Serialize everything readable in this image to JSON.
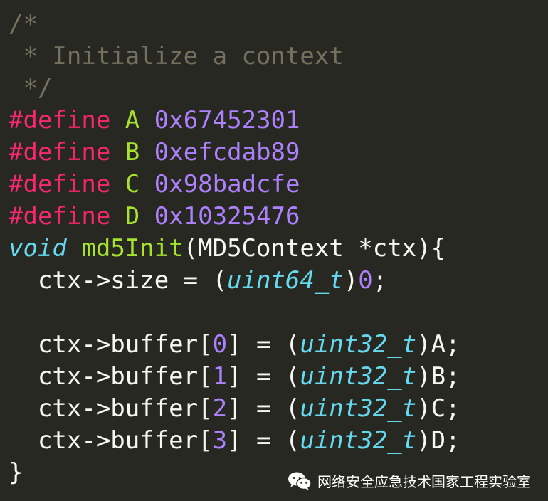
{
  "code": {
    "comment_open": "/*",
    "comment_body": " * Initialize a context",
    "comment_close": " */",
    "define_keyword": "#define",
    "defines": [
      {
        "name": "A",
        "value": "0x67452301"
      },
      {
        "name": "B",
        "value": "0xefcdab89"
      },
      {
        "name": "C",
        "value": "0x98badcfe"
      },
      {
        "name": "D",
        "value": "0x10325476"
      }
    ],
    "func_return_type": "void",
    "func_name": "md5Init",
    "func_params": "(MD5Context *ctx){",
    "size_line": {
      "lhs": "  ctx->size = (",
      "cast_type": "uint64_t",
      "close": ")",
      "value": "0",
      "end": ";"
    },
    "buffer_lines": [
      {
        "lhs": "  ctx->buffer[",
        "index": "0",
        "mid": "] = (",
        "cast_type": "uint32_t",
        "rhs": ")A;"
      },
      {
        "lhs": "  ctx->buffer[",
        "index": "1",
        "mid": "] = (",
        "cast_type": "uint32_t",
        "rhs": ")B;"
      },
      {
        "lhs": "  ctx->buffer[",
        "index": "2",
        "mid": "] = (",
        "cast_type": "uint32_t",
        "rhs": ")C;"
      },
      {
        "lhs": "  ctx->buffer[",
        "index": "3",
        "mid": "] = (",
        "cast_type": "uint32_t",
        "rhs": ")D;"
      }
    ],
    "closing_brace": "}"
  },
  "watermark": {
    "icon": "wechat-icon",
    "text": "网络安全应急技术国家工程实验室"
  },
  "colors": {
    "background": "#272822",
    "comment": "#75715e",
    "keyword": "#f92672",
    "identifier": "#a6e22e",
    "number": "#ae81ff",
    "type": "#66d9ef",
    "plain": "#f8f8f2"
  }
}
